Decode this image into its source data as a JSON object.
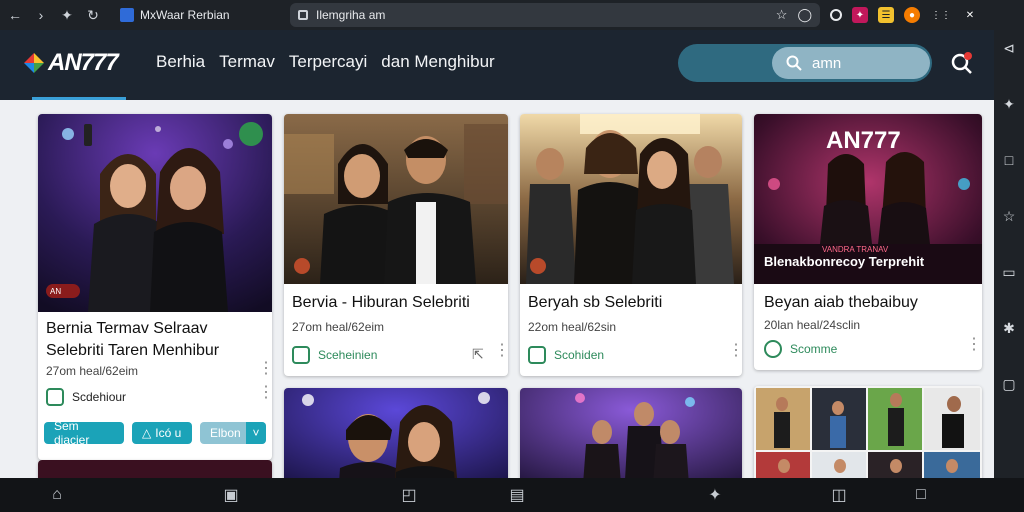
{
  "browser": {
    "tab_title": "MxWaar Rerbian",
    "address": "Ilemgriha am"
  },
  "site": {
    "logo_text": "AN777",
    "nav": [
      "Berhia",
      "Termav",
      "Terpercayi",
      "dan Menghibur"
    ],
    "search_text": "amn"
  },
  "cards": [
    {
      "title": "Bernia Termav Selraav\nSelebriti Taren Menhibur",
      "meta": "27om   heal/62eim",
      "category": "Scdehiour",
      "badge": "AN",
      "buttons": [
        "Sem diacier",
        "Icó u",
        "Elbon"
      ]
    },
    {
      "title": "Bervia - Hiburan Selebriti",
      "meta": "27om   heal/62eim",
      "category": "Sceheinien"
    },
    {
      "title": "Beryah sb Selebriti",
      "meta": "22om   heal/62sin",
      "category": "Scohiden"
    },
    {
      "title": "Beyan aiab thebaibuy",
      "meta": "20lan   heal/24sclin",
      "category": "Scomme",
      "poster_title": "AN777",
      "poster_sub": "VANDRA TRANAV",
      "poster_line": "Blenakbonrecoy Terprehit"
    }
  ],
  "colors": {
    "accent": "#3aa0d8",
    "header_bg": "#1c2530",
    "category_green": "#2d8a5b",
    "button_teal": "#1ba3b8"
  }
}
